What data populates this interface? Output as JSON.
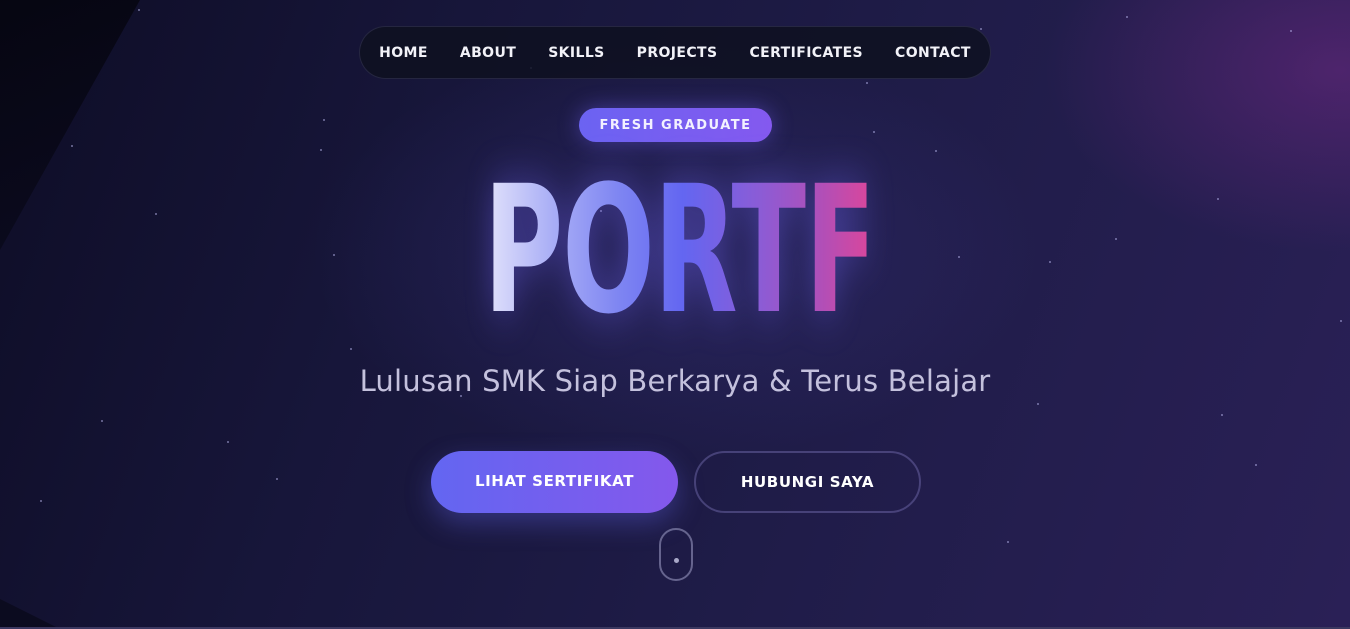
{
  "nav": {
    "items": [
      "HOME",
      "ABOUT",
      "SKILLS",
      "PROJECTS",
      "CERTIFICATES",
      "CONTACT"
    ]
  },
  "hero": {
    "badge": "FRESH GRADUATE",
    "title": "PORTFOLIO",
    "subtitle": "Lulusan SMK Siap Berkarya & Terus Belajar",
    "primary_button": "LIHAT SERTIFIKAT",
    "secondary_button": "HUBUNGI SAYA"
  },
  "icons": {
    "scroll_indicator": "mouse-scroll-icon"
  },
  "colors": {
    "accent_start": "#6366f1",
    "accent_end": "#8458ec",
    "title_end": "#d6479e",
    "background": "#17163a"
  }
}
